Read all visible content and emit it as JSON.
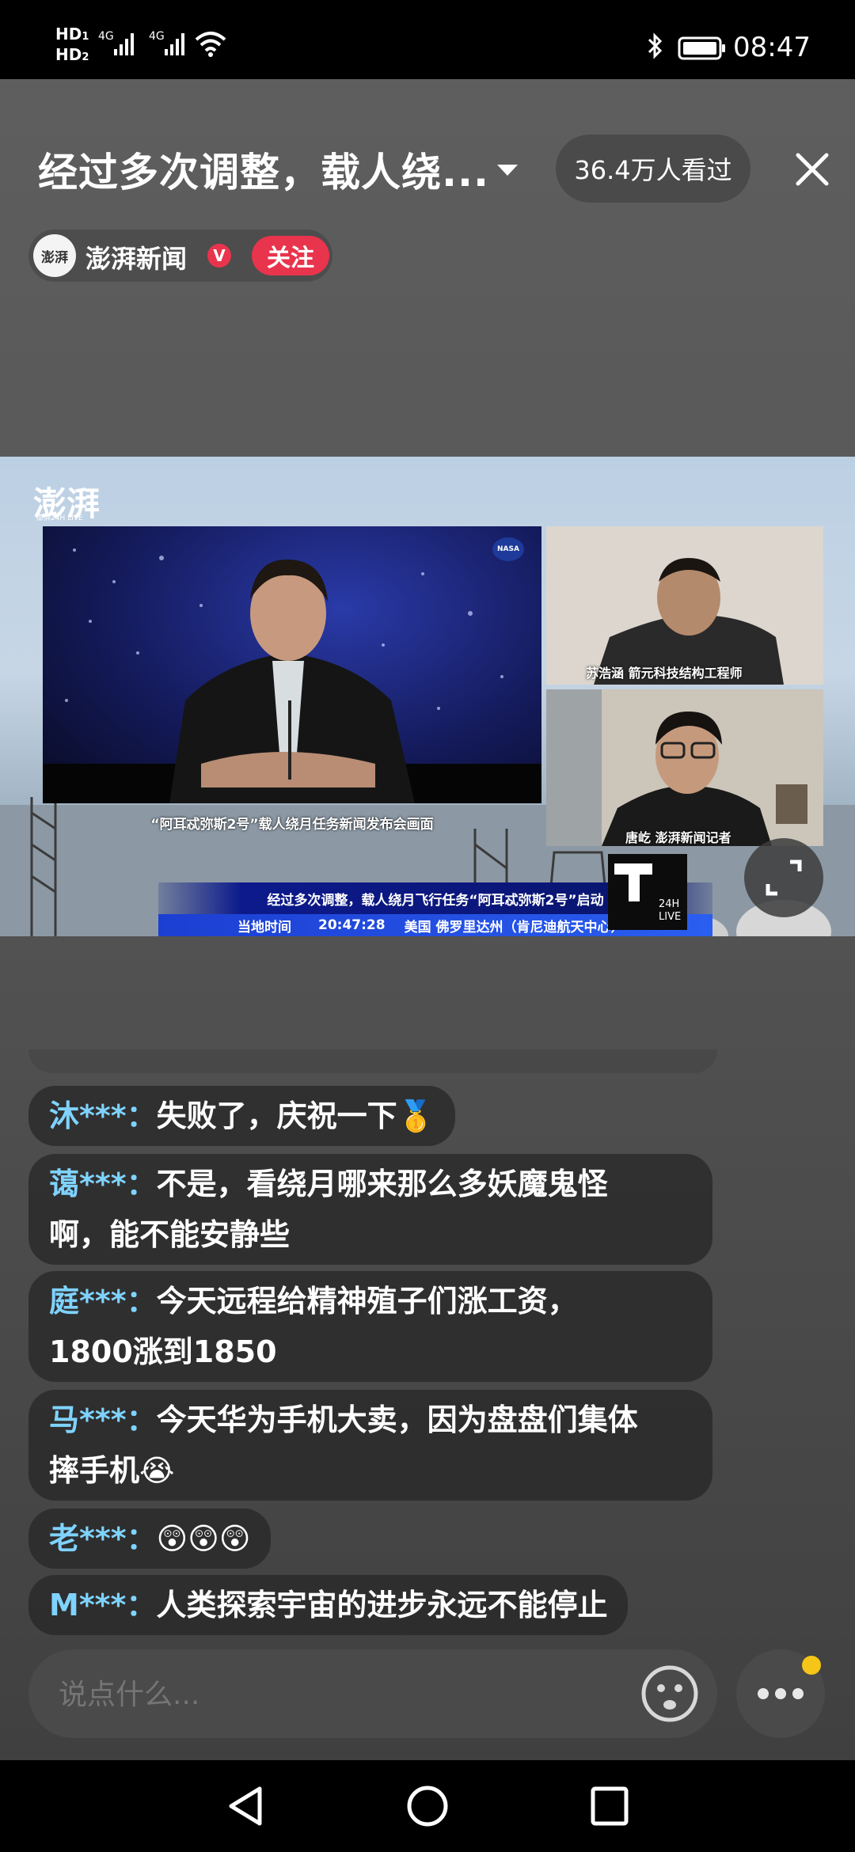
{
  "status_bar": {
    "hd1": "HD",
    "hd1_sub": "1",
    "hd2": "HD",
    "hd2_sub": "2",
    "net1": "4G",
    "net2": "4G",
    "time": "08:47"
  },
  "header": {
    "title": "经过多次调整，载人绕...",
    "viewers": "36.4万人看过",
    "channel_name": "澎湃新闻",
    "verified_badge": "V",
    "follow_label": "关注",
    "logo_text": "澎湃"
  },
  "video": {
    "logo_text": "澎湃",
    "logo_sub": "澎湃24H LIVE",
    "nasa_label": "NASA",
    "main_caption": "“阿耳忒弥斯2号”载人绕月任务新闻发布会画面",
    "guest1_name": "苏浩涵  箭元科技结构工程师",
    "guest2_name": "唐屹  澎湃新闻记者",
    "headline": "经过多次调整，载人绕月飞行任务“阿耳忒弥斯2号”启动",
    "time_label": "当地时间",
    "time_value": "20:47:28",
    "location": "美国  佛罗里达州（肯尼迪航天中心）",
    "live_logo_24h": "24H",
    "live_logo_live": "LIVE"
  },
  "comments": [
    {
      "user": "沐***：",
      "lines": [
        "失败了，庆祝一下🥇"
      ]
    },
    {
      "user": "蔼***：",
      "lines": [
        "不是，看绕月哪来那么多妖魔鬼怪",
        "啊，能不能安静些"
      ]
    },
    {
      "user": "庭***：",
      "lines": [
        "今天远程给精神殖子们涨工资，",
        "1800涨到1850"
      ]
    },
    {
      "user": "马***：",
      "lines": [
        "今天华为手机大卖，因为盘盘们集体",
        "摔手机😭"
      ]
    },
    {
      "user": "老***：",
      "lines": [
        "😲😲😲"
      ]
    },
    {
      "user": "M***：",
      "lines": [
        "人类探索宇宙的进步永远不能停止"
      ]
    }
  ],
  "input": {
    "placeholder": "说点什么..."
  },
  "icons": {
    "close": "close-icon",
    "dropdown": "chevron-down-icon",
    "fullscreen": "fullscreen-icon",
    "emoji": "emoji-icon",
    "more": "more-icon",
    "back": "nav-back-icon",
    "home": "nav-home-icon",
    "recents": "nav-recents-icon"
  },
  "colors": {
    "follow": "#e8344c",
    "username": "#7fd3ff",
    "notification_dot": "#f5c518"
  }
}
